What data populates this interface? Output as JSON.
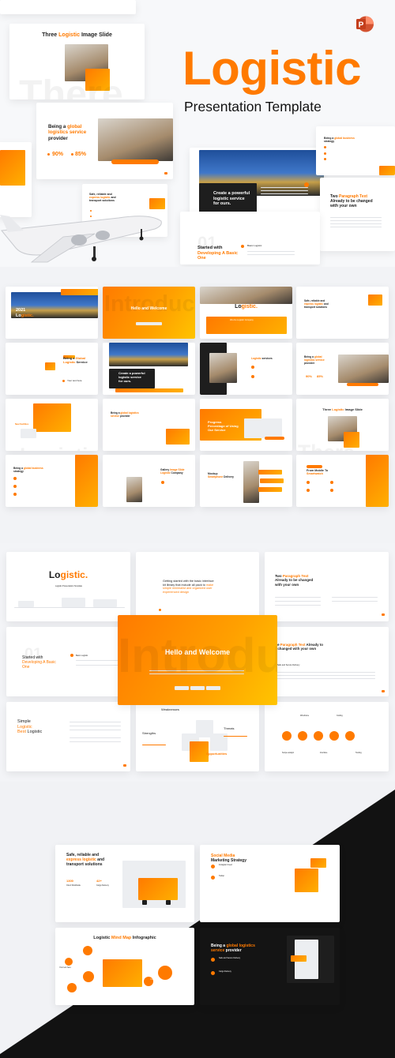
{
  "colors": {
    "accent": "#ff7a00",
    "accent_light": "#ffc400",
    "dark": "#141414"
  },
  "hero": {
    "title": "Logistic",
    "subtitle": "Presentation Template",
    "app_icon": "powerpoint-icon",
    "app_icon_letter": "P",
    "slides": [
      {
        "title": []
      },
      {
        "title": [
          {
            "t": "Three "
          },
          {
            "t": "Logistic",
            "a": 1
          },
          {
            "t": " Image Slide"
          }
        ],
        "texts": [
          {
            "t": "There",
            "s": "wm"
          }
        ]
      },
      {
        "title": [
          {
            "t": "Being a "
          },
          {
            "t": "global\nlogistics service",
            "a": 1
          },
          {
            "t": "\nprovider"
          }
        ],
        "texts": [
          {
            "t": "90%",
            "s": "a"
          },
          {
            "t": "85%",
            "s": "a"
          }
        ]
      },
      {
        "title": []
      },
      {
        "title": [
          {
            "t": "Safe, reliable and\n"
          },
          {
            "t": "express logistic",
            "a": 1
          },
          {
            "t": " and\ntransport solutions"
          }
        ]
      },
      {
        "title": [
          {
            "t": "Create a powerful\nlogistic service\nfor ours."
          }
        ],
        "white": 1
      },
      {
        "title": [
          {
            "t": "Being a "
          },
          {
            "t": "global business",
            "a": 1
          },
          {
            "t": "\nstrategy"
          }
        ]
      },
      {
        "title": [
          {
            "t": "Two "
          },
          {
            "t": "Paragraph Text",
            "a": 1
          },
          {
            "t": "\nAlready to be changed\nwith your own"
          }
        ]
      },
      {
        "title": [
          {
            "t": "Started with\n"
          },
          {
            "t": "Developing A Basic\nOne",
            "a": 1
          }
        ],
        "texts": [
          {
            "t": "01",
            "s": "wmo"
          },
          {
            "t": "Basic Logistic"
          }
        ]
      }
    ]
  },
  "grid": {
    "slides": [
      {
        "title": [
          {
            "t": "2021\n"
          },
          {
            "t": "Lo"
          },
          {
            "t": "gistic.",
            "a": 1
          }
        ],
        "white": 1,
        "texts": [
          {
            "t": "We Are Logistic Company",
            "s": "w"
          }
        ]
      },
      {
        "title": [
          {
            "t": "Hello and Welcome"
          }
        ],
        "white": 1,
        "orange": 1,
        "texts": [
          {
            "t": "Introduction",
            "s": "wmo"
          }
        ]
      },
      {
        "title": [
          {
            "t": "Lo"
          },
          {
            "t": "gistic.",
            "a": 1
          }
        ],
        "texts": [
          {
            "t": "We Are Logistic Company",
            "s": "w"
          }
        ]
      },
      {
        "title": [
          {
            "t": "Safe, reliable and\n"
          },
          {
            "t": "express logistic",
            "a": 1
          },
          {
            "t": " and\ntransport solutions"
          }
        ]
      },
      {
        "title": [
          {
            "t": "Being a "
          },
          {
            "t": "Global\nLogistic",
            "a": 1
          },
          {
            "t": " Service"
          }
        ],
        "texts": [
          {
            "t": "Your text here"
          }
        ]
      },
      {
        "title": [
          {
            "t": "Create a powerful\nlogistic service\nfor ours."
          }
        ],
        "white": 1
      },
      {
        "title": [
          {
            "t": "Logistic",
            "a": 1
          },
          {
            "t": " services"
          }
        ]
      },
      {
        "title": [
          {
            "t": "Being a "
          },
          {
            "t": "global\nlogistics service",
            "a": 1
          },
          {
            "t": "\nprovider"
          }
        ],
        "texts": [
          {
            "t": "90%",
            "s": "a"
          },
          {
            "t": "85%",
            "s": "a"
          }
        ]
      },
      {
        "title": [],
        "texts": [
          {
            "t": "New Facilities",
            "s": "a"
          },
          {
            "t": "Logistic",
            "s": "wm"
          }
        ]
      },
      {
        "title": [
          {
            "t": "Being a "
          },
          {
            "t": "global logistics\nservice",
            "a": 1
          },
          {
            "t": " provider"
          }
        ]
      },
      {
        "title": [
          {
            "t": "Progress\nPercentage of Using\nOur Service"
          }
        ],
        "white": 1
      },
      {
        "title": [
          {
            "t": "Three "
          },
          {
            "t": "Logistic",
            "a": 1
          },
          {
            "t": " Image Slide"
          }
        ],
        "texts": [
          {
            "t": "There",
            "s": "wm"
          }
        ]
      },
      {
        "title": [
          {
            "t": "Being a "
          },
          {
            "t": "global business",
            "a": 1
          },
          {
            "t": "\nstrategy"
          }
        ]
      },
      {
        "title": [
          {
            "t": "Gallery "
          },
          {
            "t": "Image Slide\nLogistic",
            "a": 1
          },
          {
            "t": " Company"
          }
        ]
      },
      {
        "title": [
          {
            "t": "Mockup\n"
          },
          {
            "t": "Smartphone",
            "a": 1
          },
          {
            "t": " Delivery"
          }
        ]
      },
      {
        "title": [
          {
            "t": "From Mobile To\n"
          },
          {
            "t": "Smartwatch",
            "a": 1
          }
        ]
      }
    ]
  },
  "feature": {
    "slides": [
      {
        "title": [
          {
            "t": "Lo"
          },
          {
            "t": "gistic.",
            "a": 1
          }
        ],
        "texts": [
          {
            "t": "Logistic Presentation Template"
          }
        ]
      },
      {
        "title": [
          {
            "t": "Getting started with the basic interface\nkit library that include all pack to "
          },
          {
            "t": "make\nsimple minimalist and organized user\nexperienced design",
            "a": 1
          }
        ],
        "light": 1
      },
      {
        "title": [
          {
            "t": "Two "
          },
          {
            "t": "Paragraph Text",
            "a": 1
          },
          {
            "t": "\nAlready to be changed\nwith your own"
          }
        ]
      },
      {
        "title": [
          {
            "t": "Started with\n"
          },
          {
            "t": "Developing A Basic\nOne",
            "a": 1
          }
        ],
        "light": 1,
        "texts": [
          {
            "t": "01",
            "s": "wmo"
          },
          {
            "t": "Basic Logistic"
          }
        ]
      },
      {
        "title": [
          {
            "t": "One "
          },
          {
            "t": "Paragraph Text",
            "a": 1
          },
          {
            "t": " Already to\nbe changed with your own"
          }
        ],
        "texts": [
          {
            "t": "Safe and Secure Delivery"
          }
        ]
      },
      {
        "title": [
          {
            "t": "Simple\n"
          },
          {
            "t": "Logistic\nBest",
            "a": 1
          },
          {
            "t": " Logistic"
          }
        ],
        "light": 1
      },
      {
        "title": [],
        "texts": [
          {
            "t": "Weaknesses"
          },
          {
            "t": "Strengths"
          },
          {
            "t": "Threats"
          },
          {
            "t": "Opportunities",
            "s": "a"
          }
        ]
      },
      {
        "title": [],
        "texts": [
          {
            "t": "Wireframe"
          },
          {
            "t": "Coding"
          },
          {
            "t": "Scope analyst"
          },
          {
            "t": "Interface"
          },
          {
            "t": "Testing"
          }
        ]
      },
      {
        "title": [
          {
            "t": "Hello and Welcome"
          }
        ],
        "white": 1,
        "orange": 1,
        "texts": [
          {
            "t": "Introduction",
            "s": "wmo"
          }
        ]
      }
    ]
  },
  "dark": {
    "slides": [
      {
        "title": [
          {
            "t": "Safe, reliable and\n"
          },
          {
            "t": "express logistic",
            "a": 1
          },
          {
            "t": " and\ntransport solutions"
          }
        ],
        "texts": [
          {
            "t": "1300",
            "s": "a"
          },
          {
            "t": "Client Worldwide"
          },
          {
            "t": "42+",
            "s": "a"
          },
          {
            "t": "Cargo Delivery"
          }
        ]
      },
      {
        "title": [
          {
            "t": "Social Media",
            "a": 1
          },
          {
            "t": "\nMarketing Strategy"
          }
        ],
        "texts": [
          {
            "t": "Instagram Feed"
          },
          {
            "t": "Twitter"
          }
        ]
      },
      {
        "title": [
          {
            "t": "Logistic "
          },
          {
            "t": "Mind Map",
            "a": 1
          },
          {
            "t": " Infographic"
          }
        ],
        "texts": [
          {
            "t": "Your text here"
          },
          {
            "t": "Your text here",
            "s": "w"
          },
          {
            "t": "Your text here",
            "s": "w"
          }
        ]
      },
      {
        "title": [
          {
            "t": "Being a "
          },
          {
            "t": "global logistics\nservice",
            "a": 1
          },
          {
            "t": " provider"
          }
        ],
        "white": 1,
        "black": 1,
        "texts": [
          {
            "t": "Safe and Secure Delivery",
            "s": "w"
          },
          {
            "t": "Cargo Delivery",
            "s": "w"
          }
        ]
      }
    ]
  }
}
